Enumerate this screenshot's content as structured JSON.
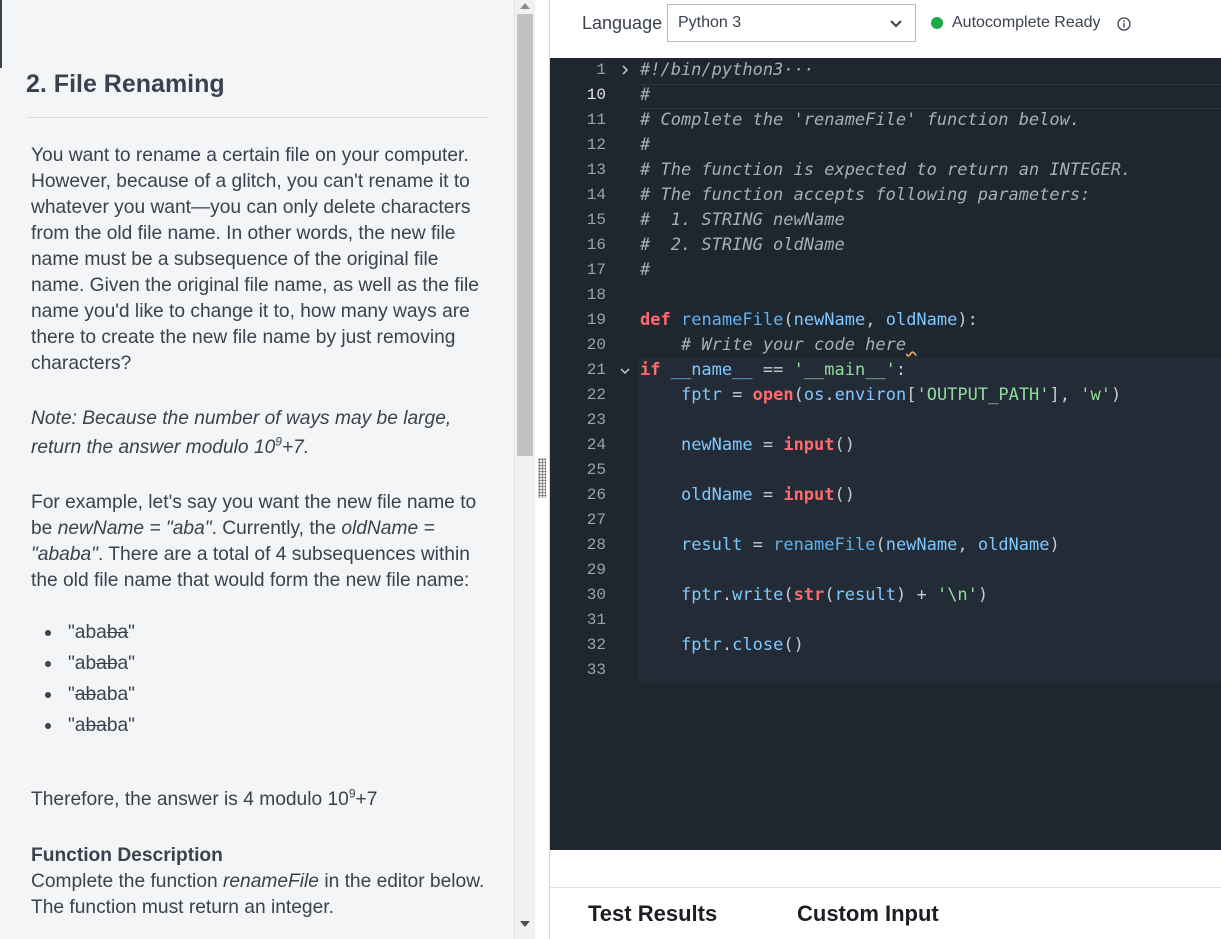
{
  "problem": {
    "title": "2. File Renaming",
    "p1": "You want to rename a certain file on your computer. However, because of a glitch, you can't rename it to whatever you want—you can only delete characters from the old file name. In other words, the new file name must be a subsequence of the original file name. Given the original file name, as well as the file name you'd like to change it to, how many ways are there to create the new file name by just removing characters?",
    "note_pre": "Note: Because the number of ways may be large, return the answer modulo 10",
    "note_sup": "9",
    "note_post": "+7.",
    "ex_a": "For example, let's say you want the new file name to be ",
    "ex_b": "newName = \"aba\"",
    "ex_c": ". Currently, the ",
    "ex_d": "oldName = \"ababa\"",
    "ex_e": ". There are a total of 4 subsequences within the old file name that would form the new file name:",
    "subsequences": [
      {
        "a": "\"aba",
        "b": "ba",
        "c": "\""
      },
      {
        "a": "\"ab",
        "b": "ab",
        "c": "a\""
      },
      {
        "a": "\"",
        "b": "ab",
        "c": "aba\""
      },
      {
        "a": "\"a",
        "b": "ba",
        "c": "ba\""
      }
    ],
    "answer_pre": "Therefore, the answer is 4 modulo 10",
    "answer_sup": "9",
    "answer_post": "+7",
    "fd_title": "Function Description",
    "fd_a": "Complete the function ",
    "fd_b": "renameFile",
    "fd_c": " in the editor below. The function must return an integer."
  },
  "toolbar": {
    "language_label": "Language",
    "language_value": "Python 3",
    "autocomplete": "Autocomplete Ready"
  },
  "editor": {
    "line_numbers": [
      "1",
      "10",
      "11",
      "12",
      "13",
      "14",
      "15",
      "16",
      "17",
      "18",
      "19",
      "20",
      "21",
      "22",
      "23",
      "24",
      "25",
      "26",
      "27",
      "28",
      "29",
      "30",
      "31",
      "32",
      "33"
    ],
    "l1": "#!/bin/python3",
    "l1_ellipsis": "···",
    "c10": "#",
    "c11": "# Complete the 'renameFile' function below.",
    "c12": "#",
    "c13": "# The function is expected to return an INTEGER.",
    "c14": "# The function accepts following parameters:",
    "c15": "#  1. STRING newName",
    "c16": "#  2. STRING oldName",
    "c17": "#",
    "kw_def": "def",
    "fn_rename": "renameFile",
    "p_open": "(",
    "id_new": "newName",
    "comma": ", ",
    "id_old": "oldName",
    "def_end": "):",
    "c20": "    # Write your code here",
    "kw_if": "if",
    "dunder_name": " __name__",
    "eq": " == ",
    "main_str": "'__main__'",
    "colon": ":",
    "fptr": "fptr",
    "assign": " = ",
    "open_fn": "open",
    "os_env": "os",
    "dot": ".",
    "environ": "environ",
    "lbr": "[",
    "out_path": "'OUTPUT_PATH'",
    "rbr": "], ",
    "w_str": "'w'",
    "rparen": ")",
    "newname_var": "newName",
    "oldname_var": "oldName",
    "input_fn": "input",
    "empty_call": "()",
    "result_var": "result",
    "write_fn": "write",
    "str_fn": "str",
    "plus": " + ",
    "nl_str": "'\\n'",
    "close_fn": "close"
  },
  "tabs": {
    "test_results": "Test Results",
    "custom_input": "Custom Input"
  }
}
